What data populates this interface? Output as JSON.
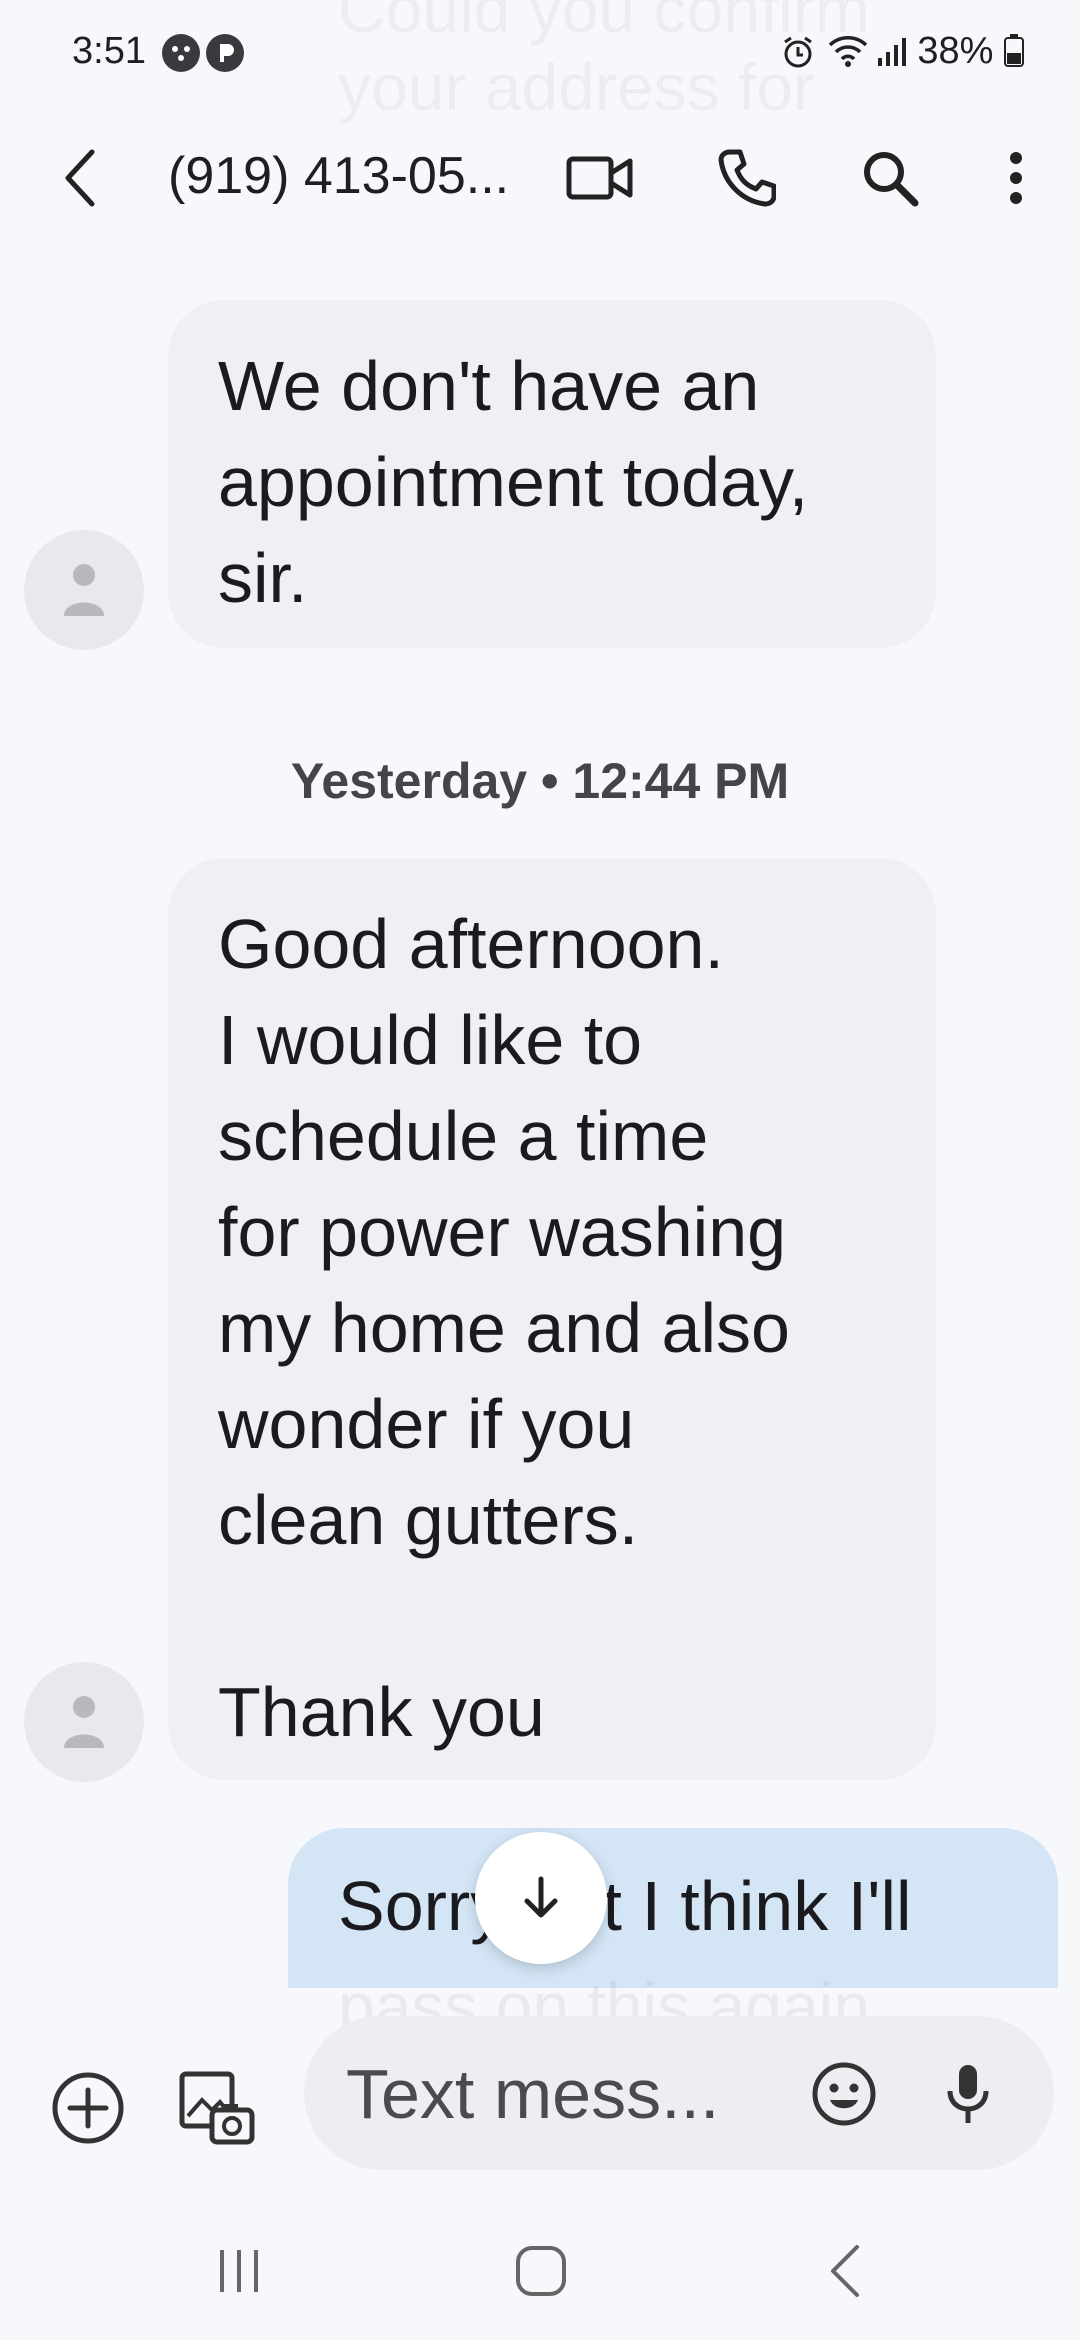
{
  "status_bar": {
    "time": "3:51",
    "battery": "38%"
  },
  "background_ghost_top": "Could you confirm your address for",
  "header": {
    "contact": "(919) 413-05...",
    "icons": [
      "back-arrow-icon",
      "video-call-icon",
      "phone-icon",
      "search-icon",
      "more-vert-icon"
    ]
  },
  "messages": {
    "incoming_1": "We don't have an\nappointment today,\nsir.",
    "date_divider": "Yesterday • 12:44 PM",
    "incoming_2": "Good afternoon.\nI would like to\nschedule a time\nfor power washing\nmy home and also\nwonder if you\nclean gutters.\n\nThank you",
    "outgoing_1": "Sorry but I think I'll",
    "outgoing_ghost": "pass on this again"
  },
  "composer": {
    "placeholder": "Text mess..."
  },
  "colors": {
    "background": "#f7f8fc",
    "incoming_bubble": "#eff0f4",
    "outgoing_bubble": "#d4e6f6"
  }
}
